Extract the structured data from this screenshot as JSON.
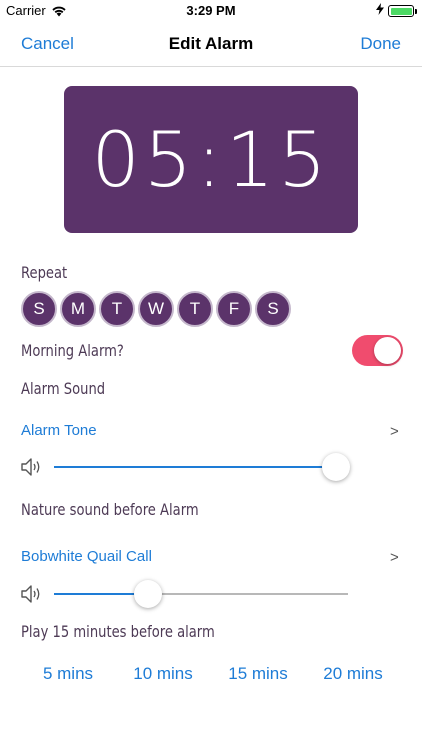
{
  "status_bar": {
    "carrier": "Carrier",
    "time": "3:29 PM"
  },
  "navbar": {
    "cancel": "Cancel",
    "title": "Edit Alarm",
    "done": "Done"
  },
  "clock": {
    "time": "05:15"
  },
  "repeat": {
    "label": "Repeat",
    "days": [
      "S",
      "M",
      "T",
      "W",
      "T",
      "F",
      "S"
    ]
  },
  "morning_alarm": {
    "label": "Morning Alarm?",
    "enabled": true
  },
  "alarm_sound": {
    "label": "Alarm Sound",
    "tone": "Alarm Tone",
    "chevron": ">",
    "volume": 0.96
  },
  "nature_sound": {
    "label": "Nature sound before Alarm",
    "sound": "Bobwhite Quail Call",
    "chevron": ">",
    "volume": 0.32
  },
  "play_before": {
    "label": "Play 15 minutes before alarm",
    "options": [
      "5 mins",
      "10 mins",
      "15 mins",
      "20 mins"
    ]
  },
  "colors": {
    "accent_blue": "#1e7cd6",
    "clock_purple": "#5b336a",
    "toggle_on": "#f04c6e"
  }
}
